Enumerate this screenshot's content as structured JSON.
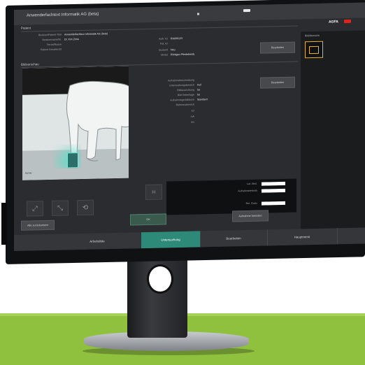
{
  "app": {
    "title": "Anwenderfachtext Informatik AG (beta)"
  },
  "brand": {
    "name": "AGFA",
    "accent": "#e2231a"
  },
  "sections": {
    "patient": "Patient",
    "image": "Bildvorschau",
    "preview": "Bildübersicht"
  },
  "patient_labels": [
    "Besitzer/Patient-Titel",
    "Besitzername/Nr.",
    "Tierart/Rasse",
    "Patient Geschlecht"
  ],
  "patient_values": [
    "Anwenderfachtext Informatik AG (beta)",
    "Dr. Kim Zirne",
    "",
    ""
  ],
  "exam_labels": [
    "Auftr. ID",
    "Pat. ID",
    "Zustand",
    "Modal"
  ],
  "exam_values": [
    "RA000123",
    "",
    "Neu",
    "Röntgen Pferdebeinb."
  ],
  "exposure_labels": [
    "Aufnahmebeschreibung",
    "Untersuchungsbereich",
    "Bildausrichtung",
    "Bild-Seitenlage",
    "Aufnahmegerätklasse",
    "Referenzbereich",
    "kV",
    "mA",
    "ms"
  ],
  "exposure_values": [
    "",
    "Huf",
    "lat",
    "lat",
    "Standard",
    "",
    "",
    "",
    ""
  ],
  "buttons": {
    "details1": "Bearbeiten",
    "details2": "Bearbeiten",
    "ok": "OK",
    "reject": "Verwerfen",
    "acquire": "Aufnahme beenden",
    "save": "Untersuchung als Entwurf speichern",
    "prev": "Alle zurücksetzen"
  },
  "tools": [
    "⤢",
    "⤡",
    "⟲",
    "⌗"
  ],
  "dark_box_labels": [
    "Lat. Abst.",
    "Aufnahmetechnik",
    "Rel. Dosis"
  ],
  "image_caption": "Huf lat.",
  "tabs": [
    {
      "label": "Arbeitsliste",
      "active": false
    },
    {
      "label": "Untersuchung",
      "active": true
    },
    {
      "label": "Bearbeiten",
      "active": false
    },
    {
      "label": "Hauptmenü",
      "active": false
    }
  ]
}
